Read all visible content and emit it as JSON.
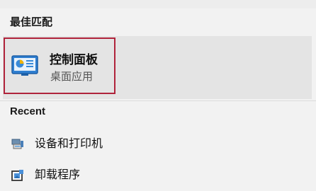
{
  "sections": {
    "best_match_title": "最佳匹配",
    "recent_title": "Recent"
  },
  "best_match": {
    "title": "控制面板",
    "subtitle": "桌面应用",
    "icon": "control-panel-icon",
    "highlight_color": "#b0233b"
  },
  "recent": {
    "items": [
      {
        "label": "设备和打印机",
        "icon": "devices-printers-icon"
      },
      {
        "label": "卸载程序",
        "icon": "uninstall-program-icon"
      }
    ]
  }
}
